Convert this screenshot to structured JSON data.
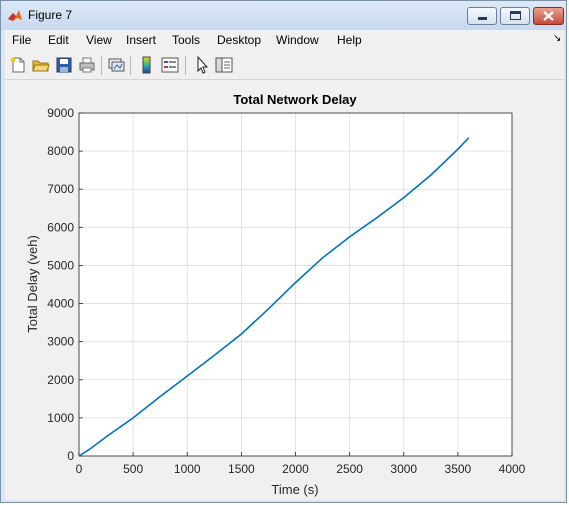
{
  "window": {
    "title": "Figure 7"
  },
  "menu": [
    "File",
    "Edit",
    "View",
    "Insert",
    "Tools",
    "Desktop",
    "Window",
    "Help"
  ],
  "toolbar": [
    "new-figure-icon",
    "open-file-icon",
    "save-icon",
    "print-icon",
    "link-plot-icon",
    "insert-colorbar-icon",
    "insert-legend-icon",
    "edit-plot-arrow-icon",
    "property-inspector-icon"
  ],
  "chart_data": {
    "type": "line",
    "title": "Total Network Delay",
    "xlabel": "Time (s)",
    "ylabel": "Total Delay (veh)",
    "xlim": [
      0,
      4000
    ],
    "ylim": [
      0,
      9000
    ],
    "xticks": [
      0,
      500,
      1000,
      1500,
      2000,
      2500,
      3000,
      3500,
      4000
    ],
    "yticks": [
      0,
      1000,
      2000,
      3000,
      4000,
      5000,
      6000,
      7000,
      8000,
      9000
    ],
    "grid": true,
    "line_color": "#0072bd",
    "series": [
      {
        "x": [
          0,
          100,
          250,
          500,
          750,
          1000,
          1250,
          1500,
          1750,
          2000,
          2250,
          2500,
          2750,
          3000,
          3250,
          3500,
          3600
        ],
        "y": [
          0,
          180,
          500,
          1000,
          1560,
          2100,
          2640,
          3200,
          3860,
          4550,
          5200,
          5750,
          6250,
          6780,
          7370,
          8050,
          8350
        ]
      }
    ]
  }
}
